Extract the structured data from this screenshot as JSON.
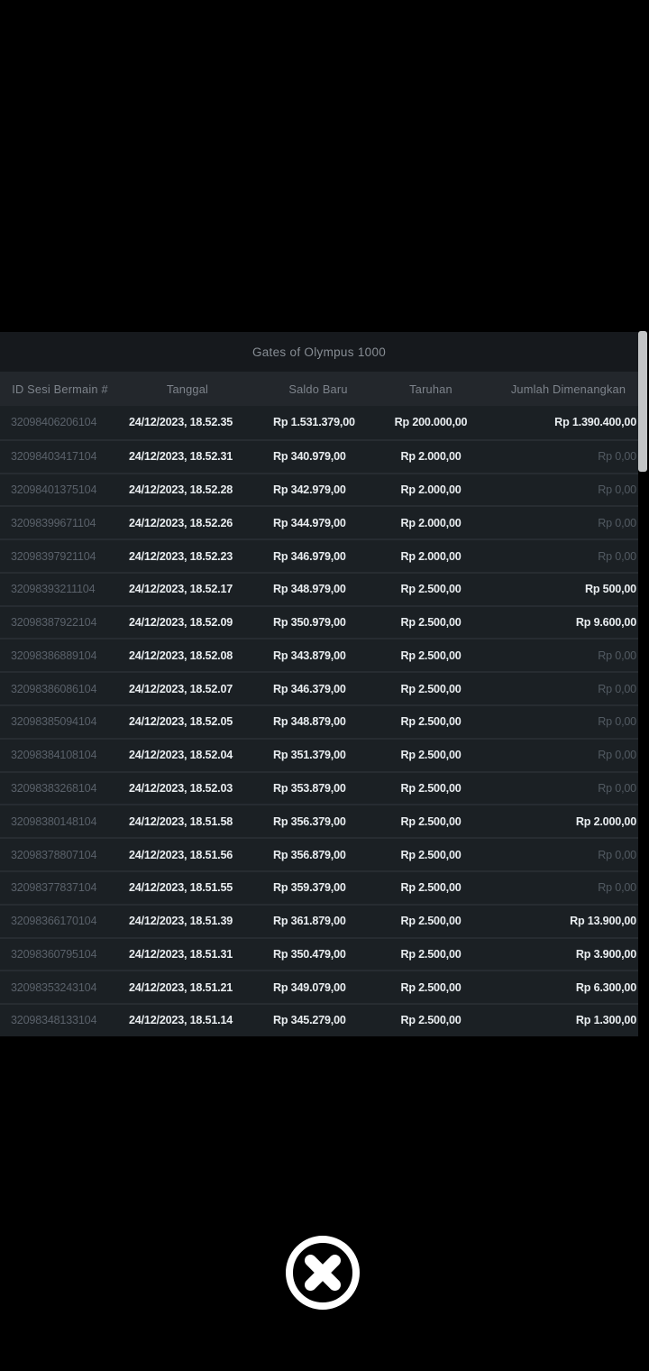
{
  "modal": {
    "title": "Gates of Olympus 1000",
    "columns": [
      {
        "label": "ID Sesi Bermain #"
      },
      {
        "label": "Tanggal"
      },
      {
        "label": "Saldo Baru"
      },
      {
        "label": "Taruhan"
      },
      {
        "label": "Jumlah Dimenangkan"
      }
    ],
    "rows": [
      {
        "id": "32098406206104",
        "date": "24/12/2023, 18.52.35",
        "balance": "Rp 1.531.379,00",
        "bet": "Rp 200.000,00",
        "win": "Rp 1.390.400,00",
        "win_muted": false
      },
      {
        "id": "32098403417104",
        "date": "24/12/2023, 18.52.31",
        "balance": "Rp 340.979,00",
        "bet": "Rp 2.000,00",
        "win": "Rp 0,00",
        "win_muted": true
      },
      {
        "id": "32098401375104",
        "date": "24/12/2023, 18.52.28",
        "balance": "Rp 342.979,00",
        "bet": "Rp 2.000,00",
        "win": "Rp 0,00",
        "win_muted": true
      },
      {
        "id": "32098399671104",
        "date": "24/12/2023, 18.52.26",
        "balance": "Rp 344.979,00",
        "bet": "Rp 2.000,00",
        "win": "Rp 0,00",
        "win_muted": true
      },
      {
        "id": "32098397921104",
        "date": "24/12/2023, 18.52.23",
        "balance": "Rp 346.979,00",
        "bet": "Rp 2.000,00",
        "win": "Rp 0,00",
        "win_muted": true
      },
      {
        "id": "32098393211104",
        "date": "24/12/2023, 18.52.17",
        "balance": "Rp 348.979,00",
        "bet": "Rp 2.500,00",
        "win": "Rp 500,00",
        "win_muted": false
      },
      {
        "id": "32098387922104",
        "date": "24/12/2023, 18.52.09",
        "balance": "Rp 350.979,00",
        "bet": "Rp 2.500,00",
        "win": "Rp 9.600,00",
        "win_muted": false
      },
      {
        "id": "32098386889104",
        "date": "24/12/2023, 18.52.08",
        "balance": "Rp 343.879,00",
        "bet": "Rp 2.500,00",
        "win": "Rp 0,00",
        "win_muted": true
      },
      {
        "id": "32098386086104",
        "date": "24/12/2023, 18.52.07",
        "balance": "Rp 346.379,00",
        "bet": "Rp 2.500,00",
        "win": "Rp 0,00",
        "win_muted": true
      },
      {
        "id": "32098385094104",
        "date": "24/12/2023, 18.52.05",
        "balance": "Rp 348.879,00",
        "bet": "Rp 2.500,00",
        "win": "Rp 0,00",
        "win_muted": true
      },
      {
        "id": "32098384108104",
        "date": "24/12/2023, 18.52.04",
        "balance": "Rp 351.379,00",
        "bet": "Rp 2.500,00",
        "win": "Rp 0,00",
        "win_muted": true
      },
      {
        "id": "32098383268104",
        "date": "24/12/2023, 18.52.03",
        "balance": "Rp 353.879,00",
        "bet": "Rp 2.500,00",
        "win": "Rp 0,00",
        "win_muted": true
      },
      {
        "id": "32098380148104",
        "date": "24/12/2023, 18.51.58",
        "balance": "Rp 356.379,00",
        "bet": "Rp 2.500,00",
        "win": "Rp 2.000,00",
        "win_muted": false
      },
      {
        "id": "32098378807104",
        "date": "24/12/2023, 18.51.56",
        "balance": "Rp 356.879,00",
        "bet": "Rp 2.500,00",
        "win": "Rp 0,00",
        "win_muted": true
      },
      {
        "id": "32098377837104",
        "date": "24/12/2023, 18.51.55",
        "balance": "Rp 359.379,00",
        "bet": "Rp 2.500,00",
        "win": "Rp 0,00",
        "win_muted": true
      },
      {
        "id": "32098366170104",
        "date": "24/12/2023, 18.51.39",
        "balance": "Rp 361.879,00",
        "bet": "Rp 2.500,00",
        "win": "Rp 13.900,00",
        "win_muted": false
      },
      {
        "id": "32098360795104",
        "date": "24/12/2023, 18.51.31",
        "balance": "Rp 350.479,00",
        "bet": "Rp 2.500,00",
        "win": "Rp 3.900,00",
        "win_muted": false
      },
      {
        "id": "32098353243104",
        "date": "24/12/2023, 18.51.21",
        "balance": "Rp 349.079,00",
        "bet": "Rp 2.500,00",
        "win": "Rp 6.300,00",
        "win_muted": false
      },
      {
        "id": "32098348133104",
        "date": "24/12/2023, 18.51.14",
        "balance": "Rp 345.279,00",
        "bet": "Rp 2.500,00",
        "win": "Rp 1.300,00",
        "win_muted": false
      }
    ]
  },
  "close_button": {
    "icon": "close-circle-icon"
  },
  "colors": {
    "background": "#000000",
    "modal_bg": "#1b2024",
    "title_bar_bg": "#16191d",
    "header_bg": "#23272c",
    "row_divider": "#272c31",
    "text_primary": "#e9edf0",
    "text_muted": "#5a616a",
    "win_muted": "#525a62",
    "scrollbar": "#c3c5c6",
    "close_icon": "#ffffff"
  }
}
